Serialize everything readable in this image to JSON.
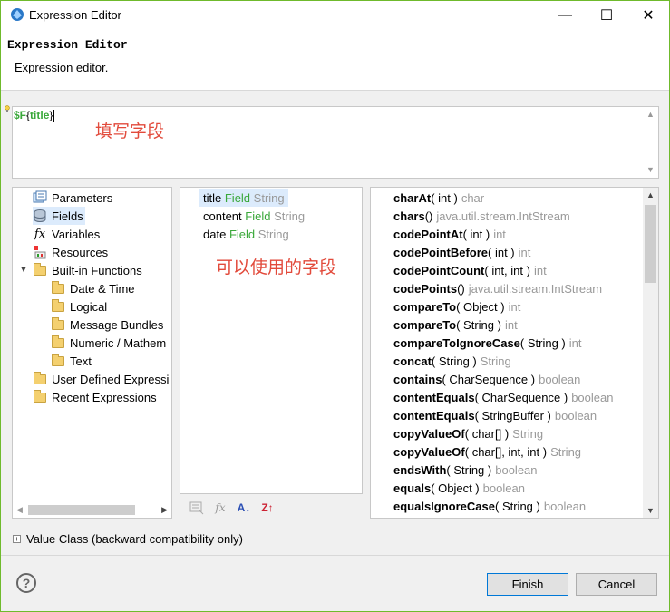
{
  "window": {
    "title": "Expression Editor",
    "minimize": "—",
    "maximize": "☐",
    "close": "✕"
  },
  "header": {
    "title": "Expression Editor",
    "description": "Expression editor."
  },
  "expression": {
    "dollar": "$F",
    "open": "{",
    "field": "title",
    "close": "}",
    "annotation": "填写字段"
  },
  "categories": {
    "items": [
      {
        "label": "Parameters",
        "icon": "parameters-icon"
      },
      {
        "label": "Fields",
        "icon": "fields-icon"
      },
      {
        "label": "Variables",
        "icon": "variables-icon"
      },
      {
        "label": "Resources",
        "icon": "resources-icon"
      },
      {
        "label": "Built-in Functions",
        "icon": "folder-icon"
      },
      {
        "label": "Date & Time",
        "icon": "folder-icon"
      },
      {
        "label": "Logical",
        "icon": "folder-icon"
      },
      {
        "label": "Message Bundles",
        "icon": "folder-icon"
      },
      {
        "label": "Numeric / Mathem",
        "icon": "folder-icon"
      },
      {
        "label": "Text",
        "icon": "folder-icon"
      },
      {
        "label": "User Defined Expressi",
        "icon": "folder-icon"
      },
      {
        "label": "Recent Expressions",
        "icon": "folder-icon"
      }
    ]
  },
  "fields": {
    "items": [
      {
        "name": "title",
        "kind": "Field",
        "type": "String"
      },
      {
        "name": "content",
        "kind": "Field",
        "type": "String"
      },
      {
        "name": "date",
        "kind": "Field",
        "type": "String"
      }
    ],
    "annotation": "可以使用的字段"
  },
  "methods": {
    "items": [
      {
        "name": "charAt",
        "args": "( int )",
        "ret": "char"
      },
      {
        "name": "chars",
        "args": "()",
        "ret": "java.util.stream.IntStream"
      },
      {
        "name": "codePointAt",
        "args": "( int )",
        "ret": "int"
      },
      {
        "name": "codePointBefore",
        "args": "( int )",
        "ret": "int"
      },
      {
        "name": "codePointCount",
        "args": "( int, int )",
        "ret": "int"
      },
      {
        "name": "codePoints",
        "args": "()",
        "ret": "java.util.stream.IntStream"
      },
      {
        "name": "compareTo",
        "args": "( Object )",
        "ret": "int"
      },
      {
        "name": "compareTo",
        "args": "( String )",
        "ret": "int"
      },
      {
        "name": "compareToIgnoreCase",
        "args": "( String )",
        "ret": "int"
      },
      {
        "name": "concat",
        "args": "( String )",
        "ret": "String"
      },
      {
        "name": "contains",
        "args": "( CharSequence )",
        "ret": "boolean"
      },
      {
        "name": "contentEquals",
        "args": "( CharSequence )",
        "ret": "boolean"
      },
      {
        "name": "contentEquals",
        "args": "( StringBuffer )",
        "ret": "boolean"
      },
      {
        "name": "copyValueOf",
        "args": "( char[] )",
        "ret": "String"
      },
      {
        "name": "copyValueOf",
        "args": "( char[], int, int )",
        "ret": "String"
      },
      {
        "name": "endsWith",
        "args": "( String )",
        "ret": "boolean"
      },
      {
        "name": "equals",
        "args": "( Object )",
        "ret": "boolean"
      },
      {
        "name": "equalsIgnoreCase",
        "args": "( String )",
        "ret": "boolean"
      }
    ]
  },
  "toolbar": {
    "sort_asc": "A↓",
    "sort_desc": "Z↑"
  },
  "value_class": {
    "expander": "+",
    "label": "Value Class (backward compatibility only)"
  },
  "footer": {
    "help": "?",
    "finish": "Finish",
    "cancel": "Cancel"
  },
  "colors": {
    "accent_border": "#6fba2c",
    "field_green": "#3aa83a",
    "annotation_red": "#e24a3b",
    "selection": "#dcebfc"
  }
}
